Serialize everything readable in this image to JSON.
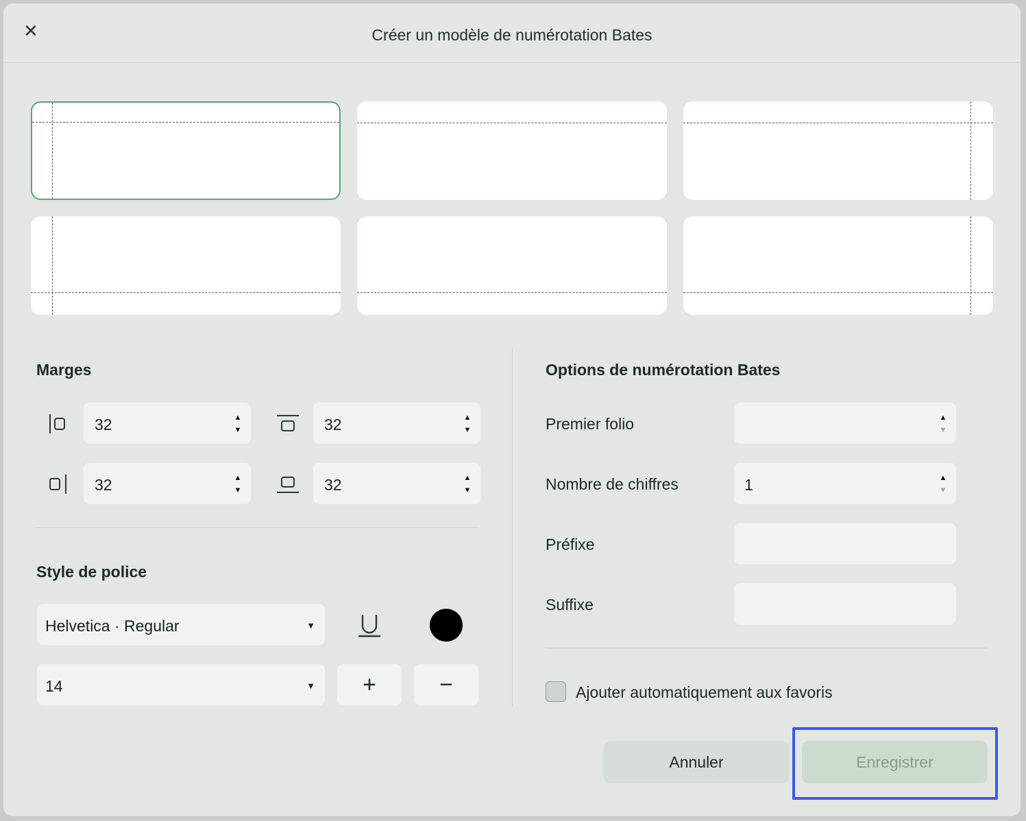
{
  "dialog": {
    "title": "Créer un modèle de numérotation Bates",
    "close_icon": "close-icon"
  },
  "positions": [
    {
      "id": "top-left",
      "selected": true
    },
    {
      "id": "top-center",
      "selected": false
    },
    {
      "id": "top-right",
      "selected": false
    },
    {
      "id": "bottom-left",
      "selected": false
    },
    {
      "id": "bottom-center",
      "selected": false
    },
    {
      "id": "bottom-right",
      "selected": false
    }
  ],
  "margins": {
    "title": "Marges",
    "left": "32",
    "top": "32",
    "right": "32",
    "bottom": "32"
  },
  "font": {
    "title": "Style de police",
    "family": "Helvetica · Regular",
    "size": "14",
    "increase_label": "+",
    "decrease_label": "−",
    "color": "#000000"
  },
  "bates": {
    "title": "Options de numérotation Bates",
    "start_label": "Premier folio",
    "start_value": "",
    "digits_label": "Nombre de chiffres",
    "digits_value": "1",
    "prefix_label": "Préfixe",
    "prefix_value": "",
    "suffix_label": "Suffixe",
    "suffix_value": "",
    "favorites_label": "Ajouter automatiquement aux favoris",
    "favorites_checked": false
  },
  "footer": {
    "cancel_label": "Annuler",
    "save_label": "Enregistrer"
  },
  "colors": {
    "accent": "#5aa478",
    "highlight": "#3d5ae8"
  }
}
